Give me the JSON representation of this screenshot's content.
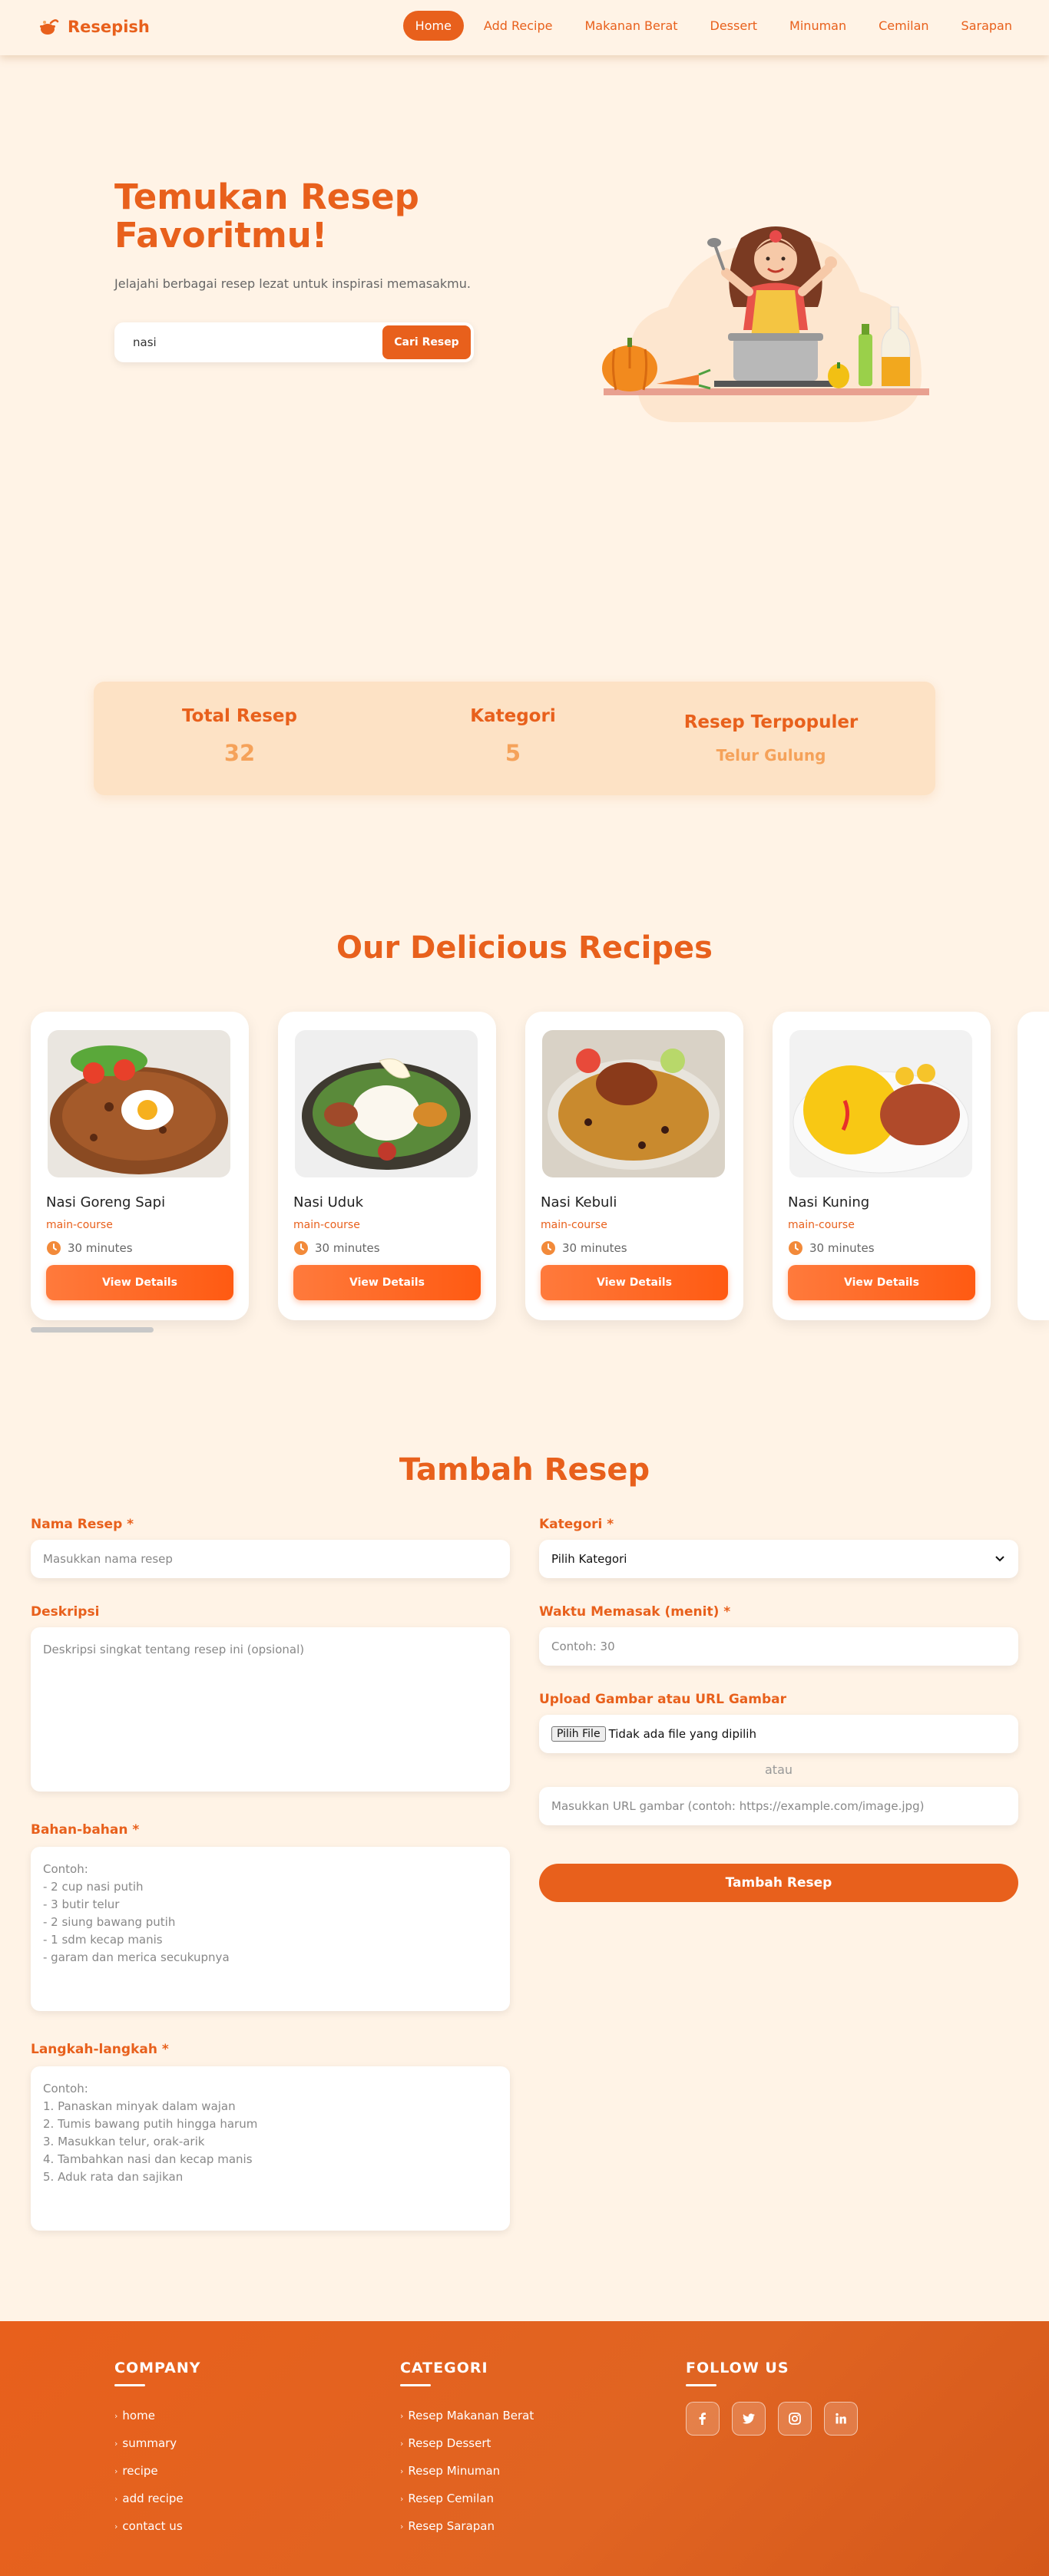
{
  "navbar": {
    "brand": "Resepish",
    "links": [
      "Home",
      "Add Recipe",
      "Makanan Berat",
      "Dessert",
      "Minuman",
      "Cemilan",
      "Sarapan"
    ],
    "active_link": "Home"
  },
  "hero": {
    "title": "Temukan Resep Favoritmu!",
    "subtitle": "Jelajahi berbagai resep lezat untuk inspirasi memasakmu.",
    "search_value": "nasi",
    "search_button": "Cari Resep"
  },
  "stats": {
    "total_label": "Total Resep",
    "total_value": "32",
    "category_label": "Kategori",
    "category_value": "5",
    "popular_label": "Resep Terpopuler",
    "popular_value": "Telur Gulung"
  },
  "recipes": {
    "title": "Our Delicious Recipes",
    "items": [
      {
        "name": "Nasi Goreng Sapi",
        "category": "main-course",
        "time": "30 minutes",
        "button": "View Details"
      },
      {
        "name": "Nasi Uduk",
        "category": "main-course",
        "time": "30 minutes",
        "button": "View Details"
      },
      {
        "name": "Nasi Kebuli",
        "category": "main-course",
        "time": "30 minutes",
        "button": "View Details"
      },
      {
        "name": "Nasi Kuning",
        "category": "main-course",
        "time": "30 minutes",
        "button": "View Details"
      }
    ]
  },
  "form": {
    "title": "Tambah Resep",
    "name_label": "Nama Resep *",
    "name_placeholder": "Masukkan nama resep",
    "description_label": "Deskripsi",
    "description_placeholder": "Deskripsi singkat tentang resep ini (opsional)",
    "ingredients_label": "Bahan-bahan *",
    "ingredients_placeholder": [
      "Contoh:",
      "- 2 cup nasi putih",
      "- 3 butir telur",
      "- 2 siung bawang putih",
      "- 1 sdm kecap manis",
      "- garam dan merica secukupnya"
    ],
    "steps_label": "Langkah-langkah *",
    "steps_placeholder": [
      "Contoh:",
      "1. Panaskan minyak dalam wajan",
      "2. Tumis bawang putih hingga harum",
      "3. Masukkan telur, orak-arik",
      "4. Tambahkan nasi dan kecap manis",
      "5. Aduk rata dan sajikan"
    ],
    "category_label": "Kategori *",
    "category_selected": "Pilih Kategori",
    "time_label": "Waktu Memasak (menit) *",
    "time_placeholder": "Contoh: 30",
    "image_label": "Upload Gambar atau URL Gambar",
    "file_button": "Pilih File",
    "file_status": "Tidak ada file yang dipilih",
    "or_text": "atau",
    "url_placeholder": "Masukkan URL gambar (contoh: https://example.com/image.jpg)",
    "submit": "Tambah Resep"
  },
  "footer": {
    "company_heading": "COMPANY",
    "company_links": [
      "home",
      "summary",
      "recipe",
      "add recipe",
      "contact us"
    ],
    "category_heading": "CATEGORI",
    "category_links": [
      "Resep Makanan Berat",
      "Resep Dessert",
      "Resep Minuman",
      "Resep Cemilan",
      "Resep Sarapan"
    ],
    "follow_heading": "FOLLOW US",
    "social_icons": [
      "facebook-icon",
      "twitter-icon",
      "instagram-icon",
      "linkedin-icon"
    ]
  },
  "colors": {
    "accent": "#e8601c",
    "background": "#fff3e6",
    "stats_bg": "#fde2c5",
    "stat_value": "#f5a25a"
  }
}
